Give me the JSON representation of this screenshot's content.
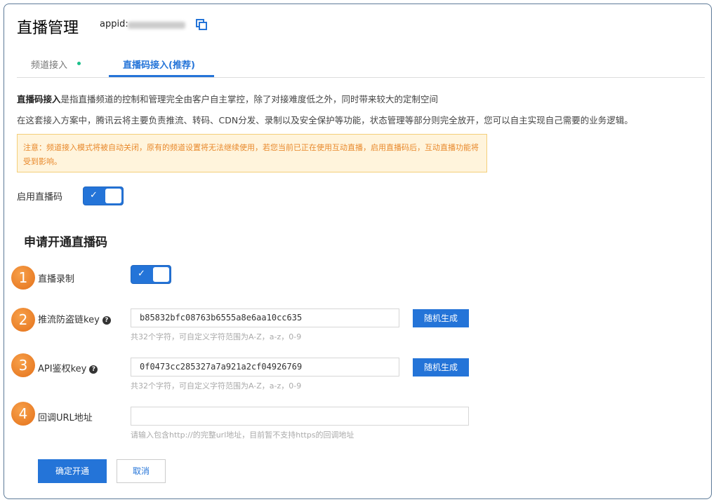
{
  "header": {
    "title": "直播管理",
    "appid_label": "appid:"
  },
  "tabs": [
    {
      "label": "频道接入"
    },
    {
      "label": "直播码接入(推荐)"
    }
  ],
  "intro": {
    "bold": "直播码接入",
    "line1": "是指直播频道的控制和管理完全由客户自主掌控，除了对接难度低之外，同时带来较大的定制空间",
    "line2": "在这套接入方案中，腾讯云将主要负责推流、转码、CDN分发、录制以及安全保护等功能，状态管理等部分则完全放开，您可以自主实现自己需要的业务逻辑。"
  },
  "warning": "注意：频道接入模式将被自动关闭，原有的频道设置将无法继续使用，若您当前已正在使用互动直播，启用直播码后，互动直播功能将受到影响。",
  "enable": {
    "label": "启用直播码",
    "on": true,
    "check": "✓"
  },
  "section_title": "申请开通直播码",
  "rows": [
    {
      "num": "1",
      "label": "直播录制",
      "on": true
    },
    {
      "num": "2",
      "label": "推流防盗链key",
      "value": "b85832bfc08763b6555a8e6aa10cc635",
      "button": "随机生成",
      "hint": "共32个字符，可自定义字符范围为A-Z，a-z，0-9"
    },
    {
      "num": "3",
      "label": "API鉴权key",
      "value": "0f0473cc285327a7a921a2cf04926769",
      "button": "随机生成",
      "hint": "共32个字符，可自定义字符范围为A-Z，a-z，0-9"
    },
    {
      "num": "4",
      "label": "回调URL地址",
      "value": "",
      "hint": "请输入包含http://的完整url地址，目前暂不支持https的回调地址"
    }
  ],
  "help_glyph": "?",
  "actions": {
    "confirm": "确定开通",
    "cancel": "取消"
  }
}
